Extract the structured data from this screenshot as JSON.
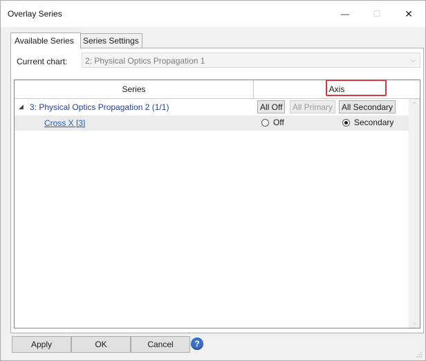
{
  "window": {
    "title": "Overlay Series",
    "minimize_glyph": "—",
    "maximize_glyph": "☐",
    "close_glyph": "✕"
  },
  "tabs": [
    {
      "label": "Available Series",
      "active": true
    },
    {
      "label": "Series Settings",
      "active": false
    }
  ],
  "current_chart": {
    "label": "Current chart:",
    "value": "2: Physical Optics Propagation 1"
  },
  "grid": {
    "headers": {
      "series": "Series",
      "axis": "Axis"
    },
    "group": {
      "label": "3: Physical Optics Propagation 2 (1/1)",
      "buttons": {
        "all_off": "All Off",
        "all_primary": "All Primary",
        "all_secondary": "All Secondary"
      }
    },
    "series": [
      {
        "name": "Cross X [3]",
        "option_off": "Off",
        "option_secondary": "Secondary",
        "selected": "Secondary"
      }
    ]
  },
  "footer": {
    "apply": "Apply",
    "ok": "OK",
    "cancel": "Cancel",
    "help": "?"
  },
  "colors": {
    "accent_link": "#1f5fb8",
    "group_text": "#1f3fa6",
    "highlight": "#d9363e",
    "help_icon": "#3b6fc6"
  }
}
